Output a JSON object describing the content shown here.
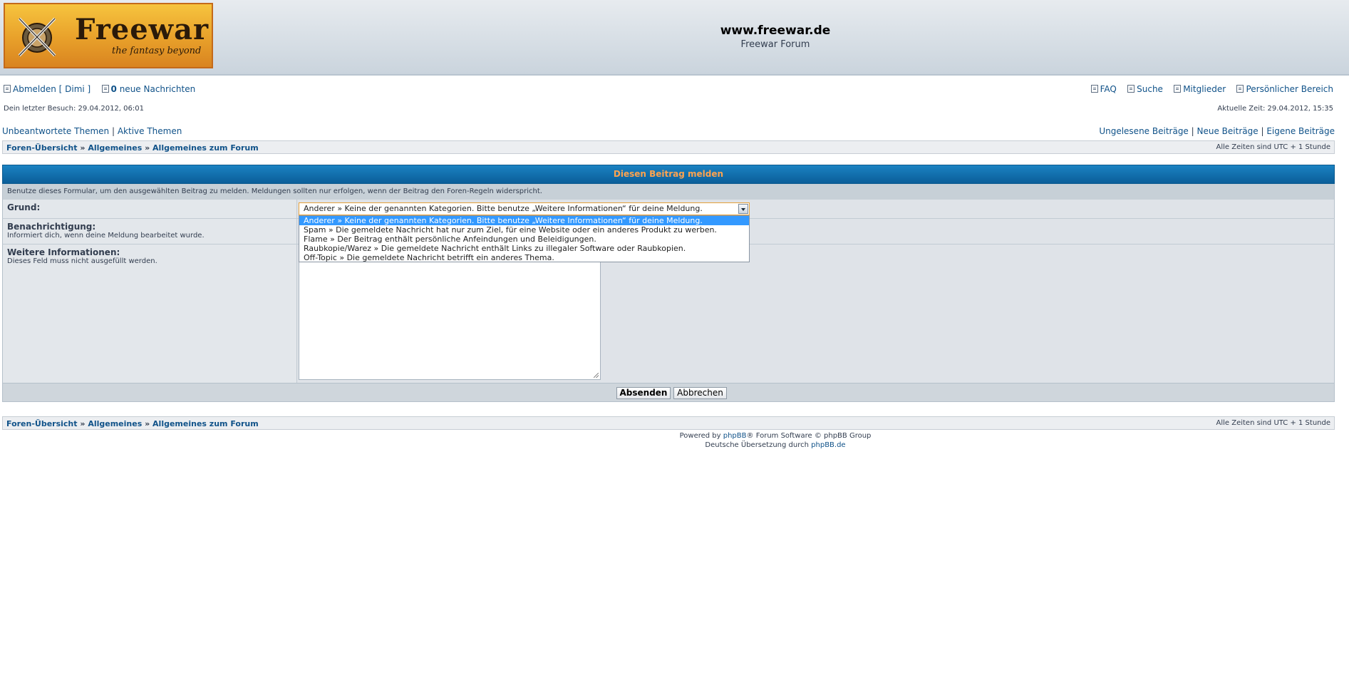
{
  "header": {
    "logo_title": "Freewar",
    "logo_subtitle": "the fantasy beyond",
    "site_title": "www.freewar.de",
    "site_description": "Freewar Forum"
  },
  "top_nav": {
    "logout": "Abmelden [ Dimi ]",
    "messages_count": "0",
    "messages_label": "neue Nachrichten",
    "faq": "FAQ",
    "search": "Suche",
    "members": "Mitglieder",
    "personal_area": "Persönlicher Bereich"
  },
  "visit_info": {
    "last_visit": "Dein letzter Besuch: 29.04.2012, 06:01",
    "current_time": "Aktuelle Zeit: 29.04.2012, 15:35"
  },
  "quick_links": {
    "unanswered": "Unbeantwortete Themen",
    "active": "Aktive Themen",
    "unread": "Ungelesene Beiträge",
    "new_posts": "Neue Beiträge",
    "own_posts": "Eigene Beiträge",
    "separator": "|"
  },
  "breadcrumb": {
    "items": [
      "Foren-Übersicht",
      "Allgemeines",
      "Allgemeines zum Forum"
    ],
    "separator": "»",
    "timezone": "Alle Zeiten sind UTC + 1 Stunde"
  },
  "report_form": {
    "title": "Diesen Beitrag melden",
    "intro": "Benutze dieses Formular, um den ausgewählten Beitrag zu melden. Meldungen sollten nur erfolgen, wenn der Beitrag den Foren-Regeln widerspricht.",
    "reason_label": "Grund:",
    "notify_label": "Benachrichtigung:",
    "notify_hint": "Informiert dich, wenn deine Meldung bearbeitet wurde.",
    "info_label": "Weitere Informationen:",
    "info_hint": "Dieses Feld muss nicht ausgefüllt werden.",
    "info_value": "",
    "selected_reason": "Anderer » Keine der genannten Kategorien. Bitte benutze „Weitere Informationen“ für deine Meldung.",
    "reason_options": [
      "Anderer » Keine der genannten Kategorien. Bitte benutze „Weitere Informationen“ für deine Meldung.",
      "Spam » Die gemeldete Nachricht hat nur zum Ziel, für eine Website oder ein anderes Produkt zu werben.",
      "Flame » Der Beitrag enthält persönliche Anfeindungen und Beleidigungen.",
      "Raubkopie/Warez » Die gemeldete Nachricht enthält Links zu illegaler Software oder Raubkopien.",
      "Off-Topic » Die gemeldete Nachricht betrifft ein anderes Thema."
    ],
    "submit": "Absenden",
    "cancel": "Abbrechen"
  },
  "footer": {
    "powered_prefix": "Powered by",
    "phpbb_link": "phpBB",
    "powered_suffix": "® Forum Software © phpBB Group",
    "translation_prefix": "Deutsche Übersetzung durch",
    "translation_link": "phpBB.de"
  }
}
